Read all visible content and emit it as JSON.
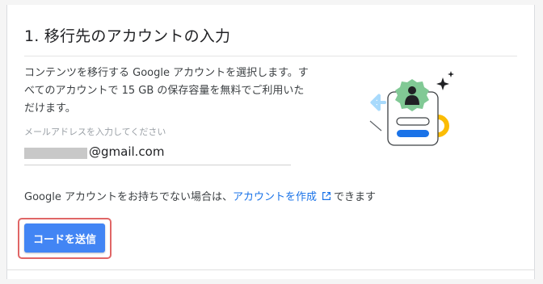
{
  "section": {
    "title": "1. 移行先のアカウントの入力",
    "description": "コンテンツを移行する Google アカウントを選択します。すべてのアカウントで 15 GB の保存容量を無料でご利用いただけます。"
  },
  "email": {
    "label": "メールアドレスを入力してください",
    "value": "@gmail.com"
  },
  "no_account": {
    "prefix": "Google アカウントをお持ちでない場合は、",
    "link": "アカウントを作成",
    "suffix": "できます"
  },
  "send_button": {
    "label": "コードを送信"
  },
  "colors": {
    "accent": "#4285f4",
    "link": "#1a73e8",
    "highlight": "#e06666",
    "illustration_green": "#81c995",
    "illustration_yellow": "#fbbc04",
    "illustration_light_blue": "#a8dafc"
  }
}
